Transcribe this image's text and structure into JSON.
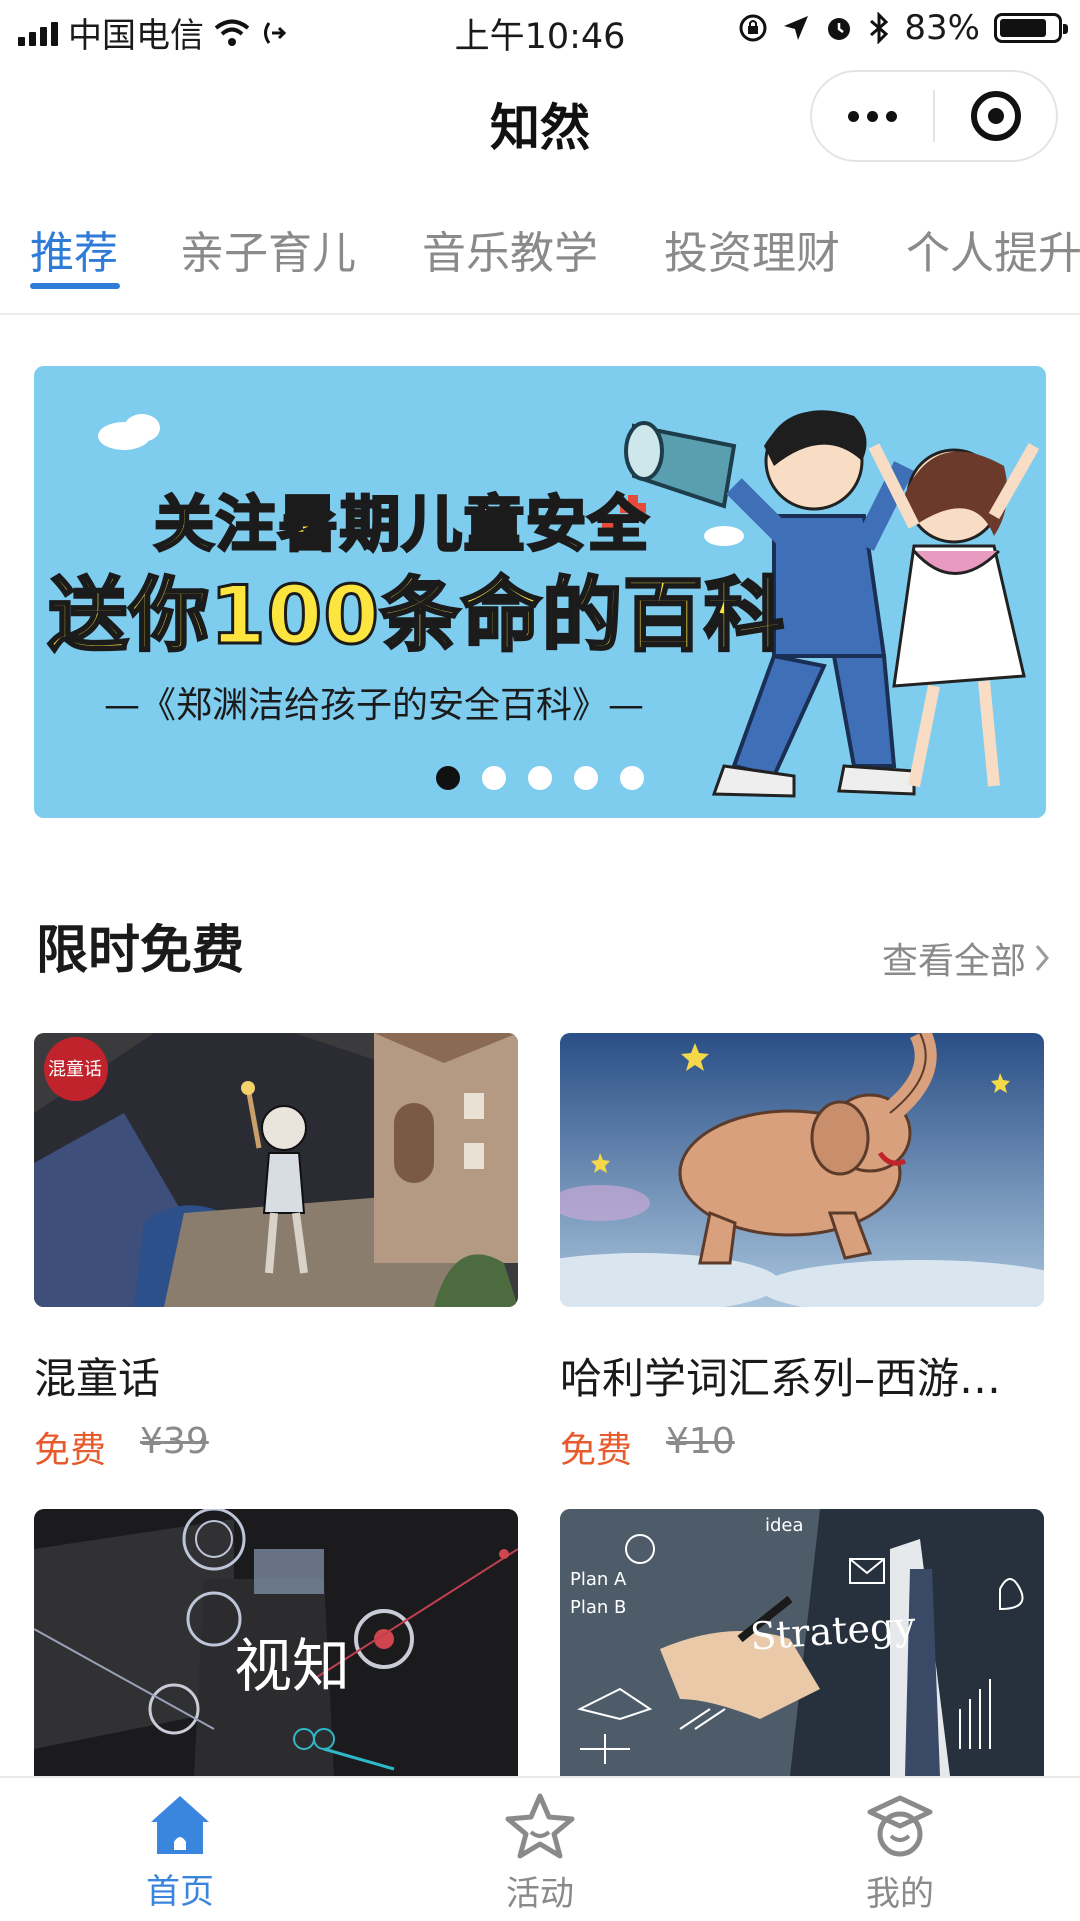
{
  "status_bar": {
    "carrier": "中国电信",
    "time": "上午10:46",
    "battery": "83%",
    "battery_level": 0.83
  },
  "nav": {
    "title": "知然",
    "capsule_icons": [
      "more-icon",
      "close-mini-program-icon"
    ]
  },
  "tabs": [
    {
      "label": "推荐",
      "active": true
    },
    {
      "label": "亲子育儿",
      "active": false
    },
    {
      "label": "音乐教学",
      "active": false
    },
    {
      "label": "投资理财",
      "active": false
    },
    {
      "label": "个人提升",
      "active": false
    }
  ],
  "banner": {
    "line1": "关注暑期儿童安全",
    "line2": "送你100条命的百科",
    "line3": "—《郑渊洁给孩子的安全百科》—",
    "slide_count": 5,
    "active_slide": 1
  },
  "section": {
    "title": "限时免费",
    "view_all": "查看全部"
  },
  "courses": [
    {
      "title": "混童话",
      "price": "免费",
      "original_price": "¥39",
      "badge": "混童话"
    },
    {
      "title": "哈利学词汇系列–西游…",
      "price": "免费",
      "original_price": "¥10"
    },
    {
      "title": "",
      "price": "",
      "original_price": "",
      "thumb_text": "视知"
    },
    {
      "title": "",
      "price": "",
      "original_price": "",
      "thumb_text": "Strategy"
    }
  ],
  "thumb_extra": {
    "plan_a": "Plan A",
    "plan_b": "Plan B",
    "idea": "idea"
  },
  "tab_bar": [
    {
      "label": "首页",
      "icon": "home-icon",
      "active": true
    },
    {
      "label": "活动",
      "icon": "star-icon",
      "active": false
    },
    {
      "label": "我的",
      "icon": "profile-icon",
      "active": false
    }
  ],
  "colors": {
    "accent": "#2f7bd8",
    "free_price": "#e75b2d",
    "muted": "#8a8a8a",
    "banner_bg": "#7fcdee"
  }
}
